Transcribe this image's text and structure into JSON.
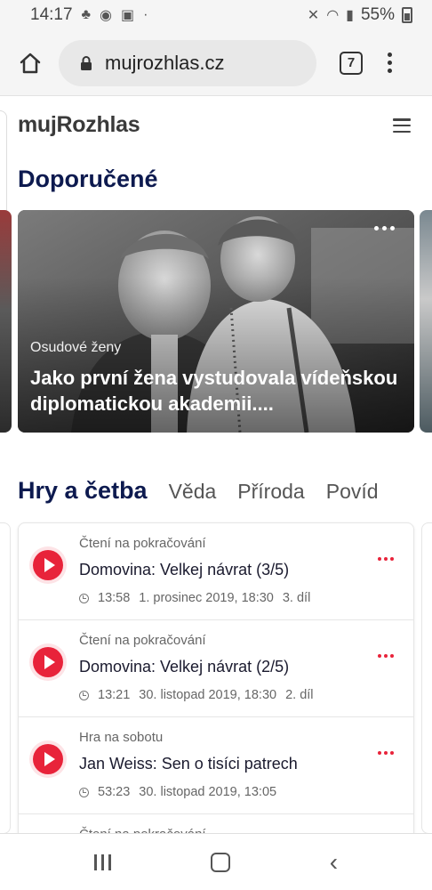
{
  "status_bar": {
    "time": "14:17",
    "battery": "55%"
  },
  "browser": {
    "url": "mujrozhlas.cz",
    "tab_count": "7"
  },
  "site": {
    "logo": "mujRozhlas"
  },
  "featured": {
    "title": "Doporučené",
    "card": {
      "tag": "Osudové ženy",
      "title": "Jako první žena vystudovala vídeňskou diplomatickou akademii...."
    }
  },
  "tabs": [
    "Hry a četba",
    "Věda",
    "Příroda",
    "Povíd"
  ],
  "episodes": [
    {
      "series": "Čtení na pokračování",
      "title": "Domovina: Velkej návrat (3/5)",
      "duration": "13:58",
      "date": "1. prosinec 2019, 18:30",
      "part": "3. díl"
    },
    {
      "series": "Čtení na pokračování",
      "title": "Domovina: Velkej návrat (2/5)",
      "duration": "13:21",
      "date": "30. listopad 2019, 18:30",
      "part": "2. díl"
    },
    {
      "series": "Hra na sobotu",
      "title": "Jan Weiss: Sen o tisíci patrech",
      "duration": "53:23",
      "date": "30. listopad 2019, 13:05",
      "part": ""
    },
    {
      "series": "Čtení na pokračování",
      "title": "",
      "duration": "",
      "date": "",
      "part": ""
    }
  ],
  "colors": {
    "accent": "#e8233a",
    "heading": "#0d1a4f"
  }
}
